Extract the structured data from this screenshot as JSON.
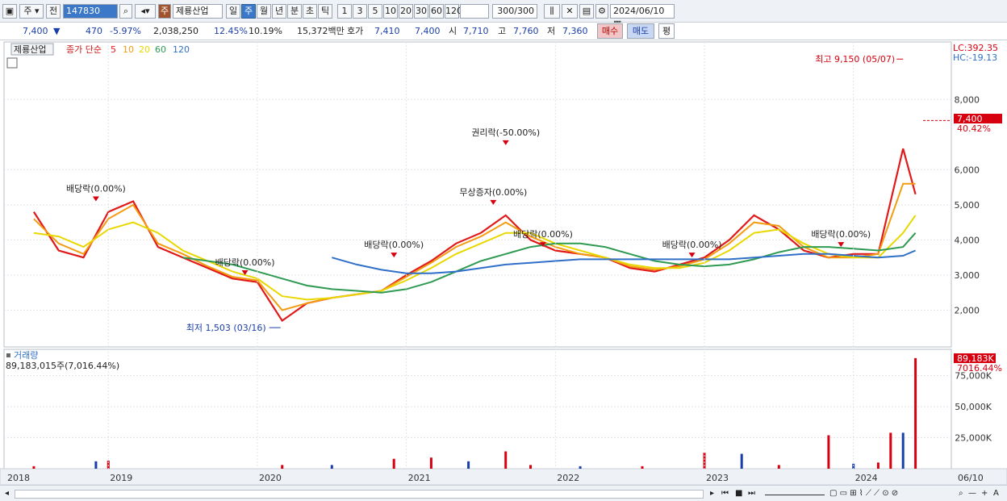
{
  "toolbar": {
    "market_sel": "주",
    "prev_label": "전",
    "code": "147830",
    "badge": "주",
    "stock_name": "제룡산업",
    "periods": [
      "일",
      "주",
      "월",
      "년",
      "분",
      "초",
      "틱"
    ],
    "active_period": "주",
    "nums": [
      "1",
      "3",
      "5",
      "10",
      "20",
      "30",
      "60",
      "120"
    ],
    "count": "300",
    "count_total": "/300",
    "date": "2024/06/10"
  },
  "quote": {
    "price": "7,400",
    "arrow": "▼",
    "change": "470",
    "change_pct": "-5.97%",
    "volume": "2,038,250",
    "turnover_pct": "12.45%",
    "rate": "10.19%",
    "amount": "15,372백만",
    "ask_label": "호가",
    "ask1": "7,410",
    "bid1": "7,400",
    "open_label": "시",
    "open": "7,710",
    "high_label": "고",
    "high": "7,760",
    "low_label": "저",
    "low": "7,360",
    "buy_label": "매수",
    "sell_label": "매도",
    "avg_label": "평"
  },
  "legend": {
    "name": "제룡산업",
    "series_label": "종가 단순",
    "ma": [
      {
        "label": "5",
        "color": "#e01a1a"
      },
      {
        "label": "10",
        "color": "#f39c12"
      },
      {
        "label": "20",
        "color": "#e8d800"
      },
      {
        "label": "60",
        "color": "#2e9a52"
      },
      {
        "label": "120",
        "color": "#2f6fc7"
      }
    ]
  },
  "right_labels": {
    "lc": "LC:392.35",
    "hc": "HC:-19.13",
    "price_tag": "7,400",
    "price_pct": "40.42%",
    "vol_tag": "89,183K",
    "vol_pct": "7016.44%"
  },
  "volume_panel": {
    "title": "거래량",
    "value": "89,183,015주(7,016.44%)"
  },
  "bottom": {
    "last_date": "06/10"
  },
  "colors": {
    "up": "#d7000f",
    "down": "#1a3ea8",
    "ma5": "#e01a1a",
    "ma10": "#f39c12",
    "ma20": "#e8d800",
    "ma60": "#2e9a52",
    "ma120": "#2f6fc7"
  },
  "chart_data": [
    {
      "type": "line",
      "title": "제룡산업",
      "x": [
        "2018-07",
        "2018-09",
        "2018-11",
        "2019-01",
        "2019-03",
        "2019-05",
        "2019-07",
        "2019-09",
        "2019-11",
        "2020-01",
        "2020-03",
        "2020-05",
        "2020-07",
        "2020-09",
        "2020-11",
        "2021-01",
        "2021-03",
        "2021-05",
        "2021-07",
        "2021-09",
        "2021-11",
        "2022-01",
        "2022-03",
        "2022-05",
        "2022-07",
        "2022-09",
        "2022-11",
        "2023-01",
        "2023-03",
        "2023-05",
        "2023-07",
        "2023-09",
        "2023-11",
        "2024-01",
        "2024-03",
        "2024-05",
        "2024-06"
      ],
      "series": [
        {
          "name": "5",
          "values": [
            4800,
            3700,
            3500,
            4800,
            5100,
            3800,
            3500,
            3200,
            2900,
            2800,
            1700,
            2200,
            2350,
            2450,
            2550,
            3000,
            3400,
            3900,
            4200,
            4700,
            4000,
            3700,
            3600,
            3500,
            3200,
            3100,
            3300,
            3500,
            4000,
            4700,
            4300,
            3700,
            3500,
            3600,
            3600,
            6600,
            5300
          ]
        },
        {
          "name": "10",
          "values": [
            4600,
            3900,
            3600,
            4600,
            5000,
            3900,
            3600,
            3250,
            2950,
            2850,
            2000,
            2200,
            2350,
            2450,
            2550,
            2950,
            3350,
            3800,
            4100,
            4500,
            4100,
            3800,
            3600,
            3500,
            3250,
            3150,
            3250,
            3450,
            3900,
            4500,
            4400,
            3800,
            3500,
            3500,
            3600,
            5600,
            5600
          ]
        },
        {
          "name": "20",
          "values": [
            4200,
            4100,
            3800,
            4300,
            4500,
            4200,
            3700,
            3400,
            3100,
            2900,
            2400,
            2300,
            2350,
            2450,
            2550,
            2850,
            3200,
            3600,
            3900,
            4200,
            4200,
            3900,
            3700,
            3500,
            3300,
            3200,
            3200,
            3350,
            3700,
            4200,
            4300,
            3900,
            3600,
            3500,
            3500,
            4200,
            4700
          ]
        },
        {
          "name": "60",
          "values": [
            null,
            null,
            null,
            null,
            null,
            null,
            3500,
            3400,
            3300,
            3100,
            2900,
            2700,
            2600,
            2550,
            2500,
            2600,
            2800,
            3100,
            3400,
            3600,
            3800,
            3900,
            3900,
            3800,
            3600,
            3400,
            3300,
            3250,
            3300,
            3450,
            3650,
            3800,
            3800,
            3750,
            3700,
            3800,
            4200
          ]
        },
        {
          "name": "120",
          "values": [
            null,
            null,
            null,
            null,
            null,
            null,
            null,
            null,
            null,
            null,
            null,
            null,
            3500,
            3300,
            3150,
            3050,
            3050,
            3100,
            3200,
            3300,
            3350,
            3400,
            3450,
            3450,
            3450,
            3450,
            3450,
            3450,
            3450,
            3500,
            3550,
            3600,
            3600,
            3550,
            3500,
            3550,
            3700
          ]
        }
      ],
      "annotations": [
        {
          "text": "최고 9,150 (05/07)",
          "x": "2024-05",
          "y": 9150
        },
        {
          "text": "최저 1,503 (03/16)",
          "x": "2020-03",
          "y": 1503
        },
        {
          "text": "권리락(-50.00%)",
          "x": "2021-09",
          "y": 6700
        },
        {
          "text": "무상증자(0.00%)",
          "x": "2021-08",
          "y": 5000
        },
        {
          "text": "배당락(0.00%)",
          "x": "2018-12",
          "y": 5100
        },
        {
          "text": "배당락(0.00%)",
          "x": "2019-12",
          "y": 3000
        },
        {
          "text": "배당락(0.00%)",
          "x": "2020-12",
          "y": 3500
        },
        {
          "text": "배당락(0.00%)",
          "x": "2021-12",
          "y": 3800
        },
        {
          "text": "배당락(0.00%)",
          "x": "2022-12",
          "y": 3500
        },
        {
          "text": "배당락(0.00%)",
          "x": "2023-12",
          "y": 3800
        }
      ],
      "y_ticks": [
        2000,
        3000,
        4000,
        5000,
        6000,
        8000
      ],
      "y_tick_labels": [
        "2,000",
        "3,000",
        "4,000",
        "5,000",
        "6,000",
        "8,000"
      ],
      "x_ticks": [
        "2018",
        "2019",
        "2020",
        "2021",
        "2022",
        "2023",
        "2024",
        "06/10"
      ],
      "last": 7400,
      "last_label": "7,400",
      "ylim": [
        1000,
        9500
      ]
    },
    {
      "type": "bar",
      "title": "거래량",
      "x": [
        "2018-07",
        "2018-12",
        "2019-01",
        "2020-03",
        "2020-07",
        "2020-12",
        "2021-03",
        "2021-06",
        "2021-09",
        "2021-11",
        "2022-03",
        "2022-08",
        "2023-01",
        "2023-04",
        "2023-07",
        "2023-11",
        "2024-01",
        "2024-03",
        "2024-04",
        "2024-05",
        "2024-06"
      ],
      "values": [
        2000,
        6000,
        6500,
        3000,
        3000,
        8000,
        9000,
        6000,
        14000,
        3000,
        2000,
        2000,
        13000,
        12000,
        3000,
        27000,
        4000,
        5000,
        29000,
        29000,
        89183
      ],
      "y_ticks": [
        25000,
        50000,
        75000
      ],
      "y_tick_labels": [
        "25,000K",
        "50,000K",
        "75,000K"
      ],
      "ylim": [
        0,
        93000
      ]
    }
  ]
}
